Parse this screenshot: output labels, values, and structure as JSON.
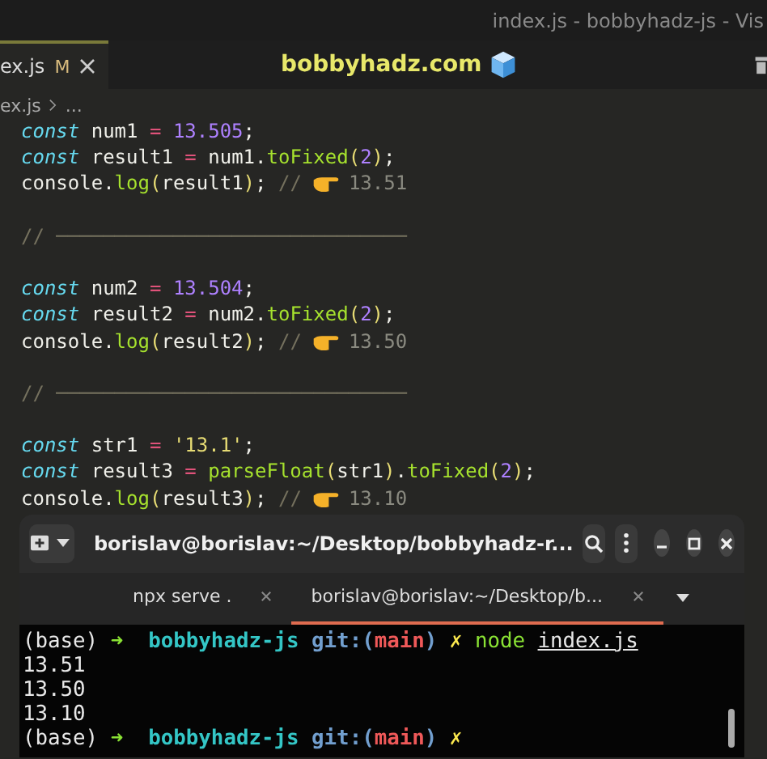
{
  "window": {
    "title": "index.js - bobbyhadz-js - Vis"
  },
  "editor_tab": {
    "label": "ex.js",
    "status": "M",
    "selected": true
  },
  "banner": "bobbyhadz.com",
  "breadcrumb": [
    "ex.js",
    "..."
  ],
  "code_blocks": [
    {
      "lines": [
        {
          "tokens": [
            {
              "kind": "keyword",
              "text": "const"
            },
            {
              "kind": "plain",
              "text": " num1 "
            },
            {
              "kind": "operator",
              "text": "= "
            },
            {
              "kind": "number",
              "text": "13.505"
            },
            {
              "kind": "plain",
              "text": ";"
            }
          ]
        },
        {
          "tokens": [
            {
              "kind": "keyword",
              "text": "const"
            },
            {
              "kind": "plain",
              "text": " result1 "
            },
            {
              "kind": "operator",
              "text": "="
            },
            {
              "kind": "plain",
              "text": " num1."
            },
            {
              "kind": "function",
              "text": "toFixed"
            },
            {
              "kind": "paren",
              "text": "("
            },
            {
              "kind": "number",
              "text": "2"
            },
            {
              "kind": "paren",
              "text": ")"
            },
            {
              "kind": "plain",
              "text": ";"
            }
          ]
        },
        {
          "tokens": [
            {
              "kind": "plain",
              "text": "console."
            },
            {
              "kind": "function",
              "text": "log"
            },
            {
              "kind": "paren",
              "text": "("
            },
            {
              "kind": "plain",
              "text": "result1"
            },
            {
              "kind": "paren",
              "text": ")"
            },
            {
              "kind": "plain",
              "text": "; "
            },
            {
              "kind": "comment",
              "text": "//"
            }
          ],
          "note": "13.51"
        }
      ]
    },
    {
      "lines": [
        {
          "tokens": [
            {
              "kind": "comment",
              "text": "// ──────────────────────────────"
            }
          ]
        }
      ]
    },
    {
      "lines": [
        {
          "tokens": [
            {
              "kind": "keyword",
              "text": "const"
            },
            {
              "kind": "plain",
              "text": " num2 "
            },
            {
              "kind": "operator",
              "text": "= "
            },
            {
              "kind": "number",
              "text": "13.504"
            },
            {
              "kind": "plain",
              "text": ";"
            }
          ]
        },
        {
          "tokens": [
            {
              "kind": "keyword",
              "text": "const"
            },
            {
              "kind": "plain",
              "text": " result2 "
            },
            {
              "kind": "operator",
              "text": "="
            },
            {
              "kind": "plain",
              "text": " num2."
            },
            {
              "kind": "function",
              "text": "toFixed"
            },
            {
              "kind": "paren",
              "text": "("
            },
            {
              "kind": "number",
              "text": "2"
            },
            {
              "kind": "paren",
              "text": ")"
            },
            {
              "kind": "plain",
              "text": ";"
            }
          ]
        },
        {
          "tokens": [
            {
              "kind": "plain",
              "text": "console."
            },
            {
              "kind": "function",
              "text": "log"
            },
            {
              "kind": "paren",
              "text": "("
            },
            {
              "kind": "plain",
              "text": "result2"
            },
            {
              "kind": "paren",
              "text": ")"
            },
            {
              "kind": "plain",
              "text": "; "
            },
            {
              "kind": "comment",
              "text": "//"
            }
          ],
          "note": "13.50"
        }
      ]
    },
    {
      "lines": [
        {
          "tokens": [
            {
              "kind": "comment",
              "text": "// ──────────────────────────────"
            }
          ]
        }
      ]
    },
    {
      "lines": [
        {
          "tokens": [
            {
              "kind": "keyword",
              "text": "const"
            },
            {
              "kind": "plain",
              "text": " str1 "
            },
            {
              "kind": "operator",
              "text": "= "
            },
            {
              "kind": "string",
              "text": "'13.1'"
            },
            {
              "kind": "plain",
              "text": ";"
            }
          ]
        },
        {
          "tokens": [
            {
              "kind": "keyword",
              "text": "const"
            },
            {
              "kind": "plain",
              "text": " result3 "
            },
            {
              "kind": "operator",
              "text": "= "
            },
            {
              "kind": "function",
              "text": "parseFloat"
            },
            {
              "kind": "paren",
              "text": "("
            },
            {
              "kind": "plain",
              "text": "str1"
            },
            {
              "kind": "paren",
              "text": ")"
            },
            {
              "kind": "plain",
              "text": "."
            },
            {
              "kind": "function",
              "text": "toFixed"
            },
            {
              "kind": "paren",
              "text": "("
            },
            {
              "kind": "number",
              "text": "2"
            },
            {
              "kind": "paren",
              "text": ")"
            },
            {
              "kind": "plain",
              "text": ";"
            }
          ]
        },
        {
          "tokens": [
            {
              "kind": "plain",
              "text": "console."
            },
            {
              "kind": "function",
              "text": "log"
            },
            {
              "kind": "paren",
              "text": "("
            },
            {
              "kind": "plain",
              "text": "result3"
            },
            {
              "kind": "paren",
              "text": ")"
            },
            {
              "kind": "plain",
              "text": "; "
            },
            {
              "kind": "comment",
              "text": "//"
            }
          ],
          "note": "13.10"
        }
      ]
    }
  ],
  "terminal": {
    "title": "borislav@borislav:~/Desktop/bobbyhadz-r...",
    "tabs": [
      {
        "label": "npx serve .",
        "selected": false
      },
      {
        "label": "borislav@borislav:~/Desktop/b...",
        "selected": true
      }
    ],
    "lines": [
      {
        "tokens": [
          {
            "kind": "plain",
            "text": "(base) "
          },
          {
            "kind": "arrow",
            "text": "➜  "
          },
          {
            "kind": "dir",
            "text": "bobbyhadz-js "
          },
          {
            "kind": "git",
            "text": "git:("
          },
          {
            "kind": "branch",
            "text": "main"
          },
          {
            "kind": "git",
            "text": ") "
          },
          {
            "kind": "dirty",
            "text": "✗ "
          },
          {
            "kind": "command",
            "text": "node "
          },
          {
            "kind": "file",
            "text": "index.js"
          }
        ]
      },
      {
        "tokens": [
          {
            "kind": "plain",
            "text": "13.51"
          }
        ]
      },
      {
        "tokens": [
          {
            "kind": "plain",
            "text": "13.50"
          }
        ]
      },
      {
        "tokens": [
          {
            "kind": "plain",
            "text": "13.10"
          }
        ]
      },
      {
        "tokens": [
          {
            "kind": "plain",
            "text": "(base) "
          },
          {
            "kind": "arrow",
            "text": "➜  "
          },
          {
            "kind": "dir",
            "text": "bobbyhadz-js "
          },
          {
            "kind": "git",
            "text": "git:("
          },
          {
            "kind": "branch",
            "text": "main"
          },
          {
            "kind": "git",
            "text": ") "
          },
          {
            "kind": "dirty",
            "text": "✗"
          }
        ]
      }
    ]
  }
}
